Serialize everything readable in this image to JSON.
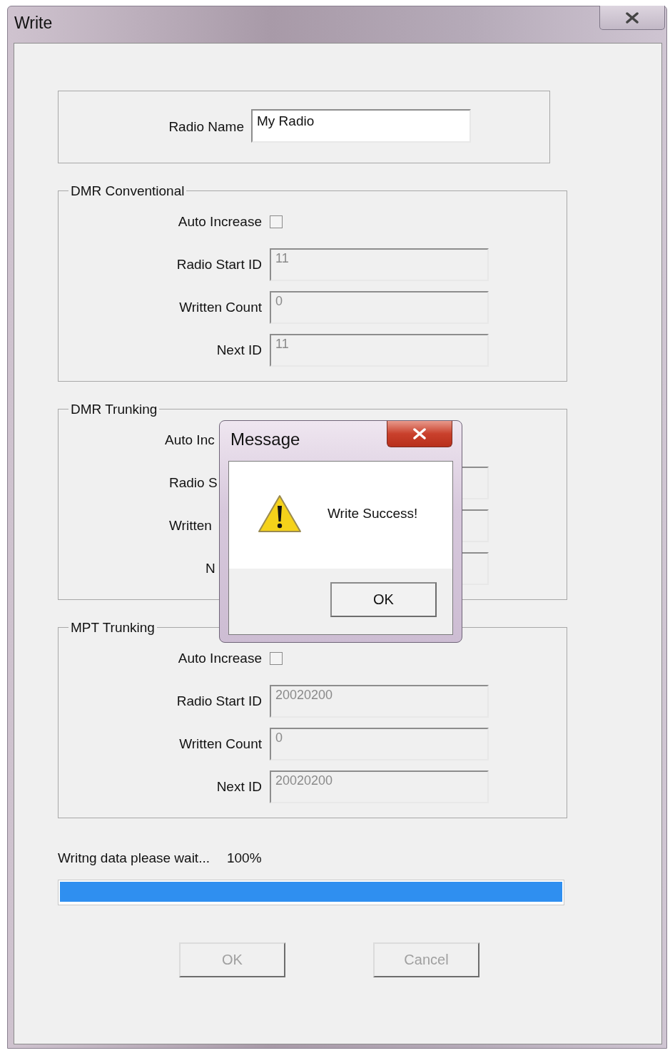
{
  "window": {
    "title": "Write"
  },
  "radio_name": {
    "label": "Radio Name",
    "value": "My Radio"
  },
  "groups": [
    {
      "title": "DMR Conventional",
      "covered": false,
      "rows": [
        {
          "kind": "checkbox",
          "label": "Auto Increase",
          "checked": false
        },
        {
          "kind": "field",
          "label": "Radio Start ID",
          "value": "11",
          "disabled": true
        },
        {
          "kind": "field",
          "label": "Written Count",
          "value": "0",
          "disabled": true
        },
        {
          "kind": "field",
          "label": "Next ID",
          "value": "11",
          "disabled": true
        }
      ]
    },
    {
      "title": "DMR Trunking",
      "covered": true,
      "rows": [
        {
          "kind": "checkbox",
          "label": "Auto Inc"
        },
        {
          "kind": "field",
          "label": "Radio S"
        },
        {
          "kind": "field",
          "label": "Written"
        },
        {
          "kind": "field",
          "label": "N"
        }
      ]
    },
    {
      "title": "MPT Trunking",
      "covered": false,
      "rows": [
        {
          "kind": "checkbox",
          "label": "Auto Increase",
          "checked": false
        },
        {
          "kind": "field",
          "label": "Radio Start ID",
          "value": "20020200",
          "disabled": true
        },
        {
          "kind": "field",
          "label": "Written Count",
          "value": "0",
          "disabled": true
        },
        {
          "kind": "field",
          "label": "Next ID",
          "value": "20020200",
          "disabled": true
        }
      ]
    }
  ],
  "progress": {
    "label": "Writng data please wait...",
    "percent": "100%",
    "level": 1
  },
  "buttons": [
    {
      "label": "OK",
      "disabled": true
    },
    {
      "label": "Cancel",
      "disabled": true
    }
  ],
  "dialog": {
    "title": "Message",
    "text": "Write Success!",
    "button": "OK"
  }
}
